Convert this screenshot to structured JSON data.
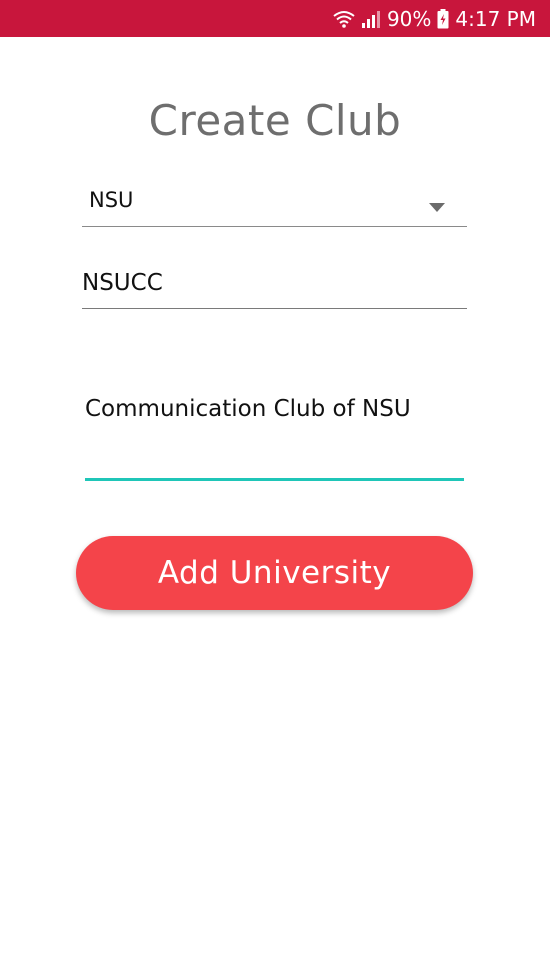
{
  "status_bar": {
    "battery_percent": "90%",
    "time": "4:17 PM",
    "wifi_icon": "wifi-icon",
    "signal_icon": "signal-icon",
    "battery_icon": "battery-charging-icon",
    "background_color": "#c8163c"
  },
  "form": {
    "title": "Create Club",
    "university_select": {
      "value": "NSU",
      "icon": "dropdown-arrow-icon"
    },
    "club_short_name": {
      "value": "NSUCC"
    },
    "club_description": {
      "value": "Communication Club of NSU",
      "accent_color": "#1fc6b8"
    },
    "submit_button": {
      "label": "Add University",
      "color": "#f4444a"
    }
  }
}
